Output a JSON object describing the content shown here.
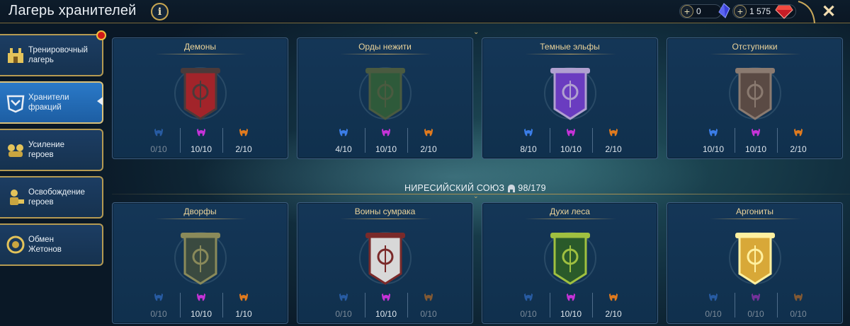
{
  "header": {
    "title": "Лагерь хранителей",
    "info_symbol": "i",
    "close_symbol": "✕",
    "resources": [
      {
        "icon": "blue-gem-icon",
        "plus": "+",
        "value": "0"
      },
      {
        "icon": "red-ruby-icon",
        "plus": "+",
        "value": "1 575"
      }
    ]
  },
  "sidebar": {
    "items": [
      {
        "label": "Тренировочный\nлагерь",
        "icon": "training-camp-icon",
        "active": false
      },
      {
        "label": "Хранители\nфракций",
        "icon": "faction-guardians-icon",
        "active": true
      },
      {
        "label": "Усиление\nгероев",
        "icon": "hero-boost-icon",
        "active": false
      },
      {
        "label": "Освобождение\nгероев",
        "icon": "hero-release-icon",
        "active": false
      },
      {
        "label": "Обмен\nЖетонов",
        "icon": "token-exchange-icon",
        "active": false
      }
    ]
  },
  "colors": {
    "rare": "#3b7de8",
    "epic": "#c633d8",
    "legendary": "#e07a1e"
  },
  "divider": {
    "label": "НИРЕСИЙСКИЙ СОЮЗ",
    "value": "98/179",
    "icon": "helmet-icon"
  },
  "factions": [
    {
      "name": "Демоны",
      "banner": "demon-banner-icon",
      "stats": [
        "0/10",
        "10/10",
        "2/10"
      ],
      "dim": [
        true,
        false,
        false
      ]
    },
    {
      "name": "Орды нежити",
      "banner": "undead-banner-icon",
      "stats": [
        "4/10",
        "10/10",
        "2/10"
      ],
      "dim": [
        false,
        false,
        false
      ]
    },
    {
      "name": "Темные эльфы",
      "banner": "dark-elf-banner-icon",
      "stats": [
        "8/10",
        "10/10",
        "2/10"
      ],
      "dim": [
        false,
        false,
        false
      ]
    },
    {
      "name": "Отступники",
      "banner": "renegade-banner-icon",
      "stats": [
        "10/10",
        "10/10",
        "2/10"
      ],
      "dim": [
        false,
        false,
        false
      ]
    },
    {
      "name": "Дворфы",
      "banner": "dwarf-banner-icon",
      "stats": [
        "0/10",
        "10/10",
        "1/10"
      ],
      "dim": [
        true,
        false,
        false
      ]
    },
    {
      "name": "Воины сумрака",
      "banner": "shadowkin-banner-icon",
      "stats": [
        "0/10",
        "10/10",
        "0/10"
      ],
      "dim": [
        true,
        false,
        true
      ]
    },
    {
      "name": "Духи леса",
      "banner": "sylvan-banner-icon",
      "stats": [
        "0/10",
        "10/10",
        "2/10"
      ],
      "dim": [
        true,
        false,
        false
      ]
    },
    {
      "name": "Аргониты",
      "banner": "argonite-banner-icon",
      "stats": [
        "0/10",
        "0/10",
        "0/10"
      ],
      "dim": [
        true,
        true,
        true
      ]
    }
  ]
}
